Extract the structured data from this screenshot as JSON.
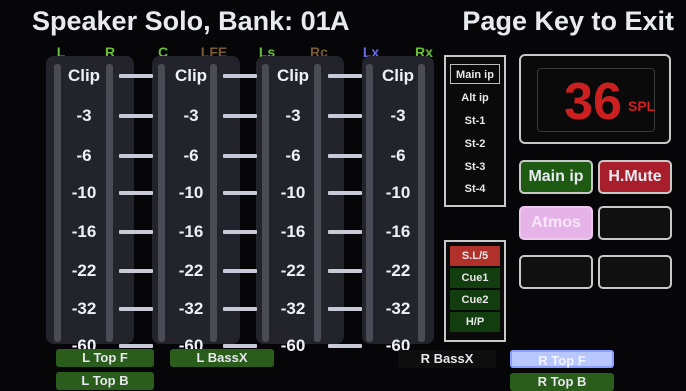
{
  "header": {
    "title": "Speaker Solo, Bank: 01",
    "bank_letter": "A",
    "exit_hint": "Page Key to Exit"
  },
  "channels": [
    {
      "label": "L",
      "color": "#6abf3a"
    },
    {
      "label": "R",
      "color": "#6abf3a"
    },
    {
      "label": "C",
      "color": "#6abf3a"
    },
    {
      "label": "LFE",
      "color": "#7a5a32"
    },
    {
      "label": "Ls",
      "color": "#6abf3a"
    },
    {
      "label": "Rc",
      "color": "#7a5a32"
    },
    {
      "label": "Lx",
      "color": "#6a6ae8"
    },
    {
      "label": "Rx",
      "color": "#6abf3a"
    }
  ],
  "meter_scale": [
    "Clip",
    "-3",
    "-6",
    "-10",
    "-16",
    "-22",
    "-32",
    "-60"
  ],
  "input_select": {
    "items": [
      "Main ip",
      "Alt ip",
      "St-1",
      "St-2",
      "St-3",
      "St-4"
    ],
    "selected": "Main ip"
  },
  "monitor_select": {
    "items": [
      "S.L/5",
      "Cue1",
      "Cue2",
      "H/P"
    ],
    "active": "S.L/5"
  },
  "spl": {
    "value": "36",
    "unit": "SPL"
  },
  "buttons": {
    "main_ip": "Main ip",
    "hmute": "H.Mute",
    "atmos": "Atmos"
  },
  "extra_speakers": {
    "l_top_f": "L Top F",
    "l_bassx": "L BassX",
    "r_bassx": "R BassX",
    "r_top_f": "R Top F",
    "l_top_b": "L Top B",
    "r_top_b": "R Top B"
  },
  "colors": {
    "active_green": "#2a5c1c",
    "active_red": "#b0302a",
    "spl_red": "#cc2020",
    "atmos_pink": "#e6b3e8",
    "selected_blue": "#b8c8ff"
  }
}
